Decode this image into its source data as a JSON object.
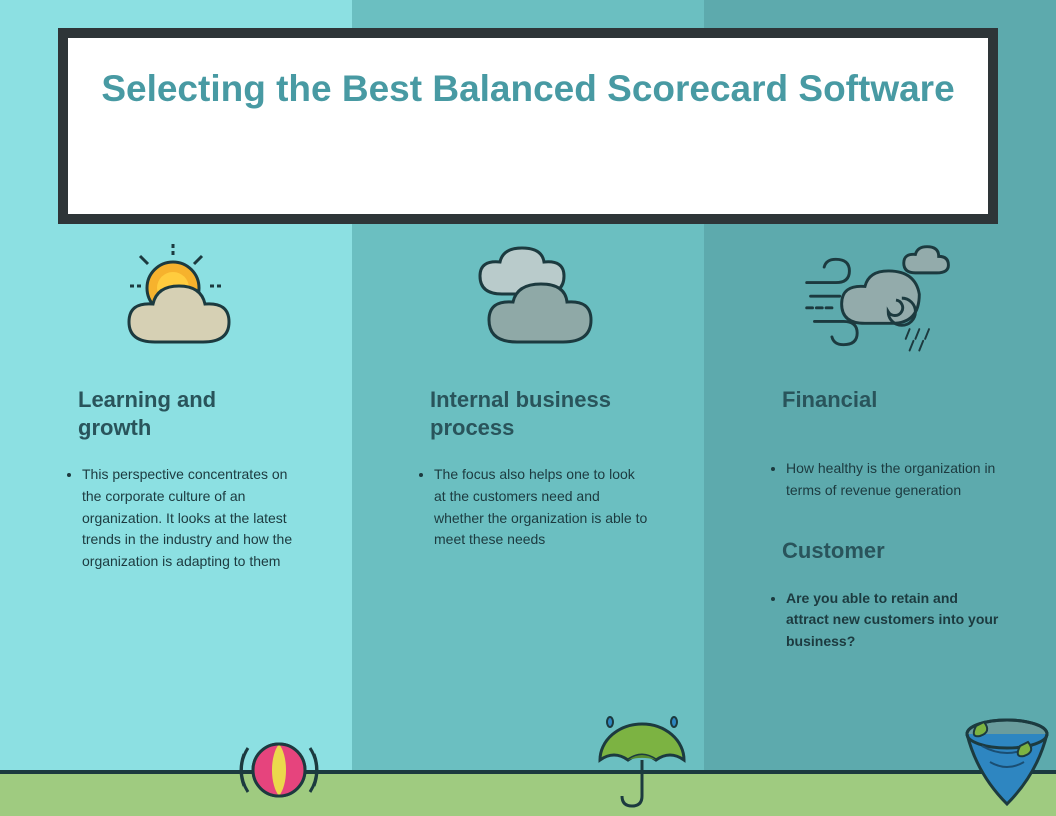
{
  "title": "Selecting the Best Balanced Scorecard Software",
  "columns": {
    "learning": {
      "heading": "Learning and growth",
      "bullet": "This perspective concentrates on the corporate culture of an organization. It looks at the latest trends in the industry and how the  organization is adapting to them"
    },
    "process": {
      "heading": "Internal business process",
      "bullet": "The focus also helps one to look at the customers need and whether the organization is able to meet these needs"
    },
    "financial": {
      "heading": "Financial",
      "bullet": "How healthy is the organization in terms of revenue generation"
    },
    "customer": {
      "heading": "Customer",
      "bullet": "Are you able to retain and attract new customers into your business?"
    }
  }
}
